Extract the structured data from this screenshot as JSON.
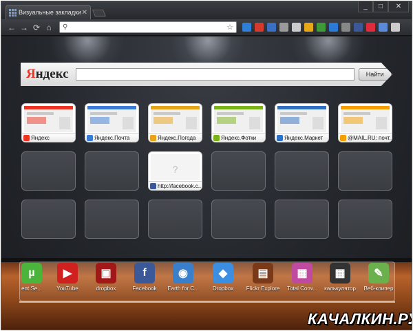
{
  "tab": {
    "title": "Визуальные закладки",
    "close": "✕"
  },
  "window_buttons": {
    "minimize": "_",
    "maximize": "□",
    "close": "✕"
  },
  "nav": {
    "back": "←",
    "forward": "→",
    "reload": "⟳",
    "home": "⌂"
  },
  "omnibox": {
    "value": "",
    "search_icon": "search-icon",
    "star": "☆"
  },
  "extensions": [
    {
      "name": "extension-1-icon",
      "color": "#2f7fd6"
    },
    {
      "name": "extension-2-icon",
      "color": "#d63a2f"
    },
    {
      "name": "extension-3-icon",
      "color": "#3a6fc4"
    },
    {
      "name": "extension-4-icon",
      "color": "#9a9a9a"
    },
    {
      "name": "extension-5-icon",
      "color": "#cccccc"
    },
    {
      "name": "extension-6-icon",
      "color": "#e6a817"
    },
    {
      "name": "extension-7-icon",
      "color": "#3d9a37"
    },
    {
      "name": "extension-8-icon",
      "color": "#2a7ad6"
    },
    {
      "name": "extension-9-icon",
      "color": "#888888"
    },
    {
      "name": "extension-10-icon",
      "color": "#3b5998"
    },
    {
      "name": "extension-11-icon",
      "color": "#e02b3c"
    },
    {
      "name": "extension-12-icon",
      "color": "#5a8ad8"
    },
    {
      "name": "wrench-icon",
      "color": "#cccccc"
    }
  ],
  "yandex": {
    "logo_first": "Я",
    "logo_rest": "ндекс",
    "search_value": "",
    "button": "Найти"
  },
  "bookmarks": [
    {
      "label": "Яндекс",
      "color": "#e32"
    },
    {
      "label": "Яндекс.Почта",
      "color": "#3a7bd5"
    },
    {
      "label": "Яндекс.Погода",
      "color": "#e8a317"
    },
    {
      "label": "Яндекс.Фотки",
      "color": "#7ab317"
    },
    {
      "label": "Яндекс.Маркет",
      "color": "#2f6fc4"
    },
    {
      "label": "@MAIL.RU: почт...",
      "color": "#f4a000"
    },
    {
      "label": "http://facebook.c...",
      "color": "#3b5998",
      "placeholder": "?"
    }
  ],
  "dock_apps": [
    {
      "label": "ent Se...",
      "icon": "µ",
      "color": "#4bb43a",
      "icon_name": "utorrent-icon"
    },
    {
      "label": "YouTube",
      "icon": "▶",
      "color": "#d02020",
      "icon_name": "youtube-icon"
    },
    {
      "label": "dropbox",
      "icon": "▣",
      "color": "#a01818",
      "icon_name": "dropbox-red-icon"
    },
    {
      "label": "Facebook",
      "icon": "f",
      "color": "#3b5998",
      "icon_name": "facebook-icon"
    },
    {
      "label": "Earth for C...",
      "icon": "◉",
      "color": "#3a7fc9",
      "icon_name": "earth-icon"
    },
    {
      "label": "Dropbox",
      "icon": "◆",
      "color": "#3b8ee0",
      "icon_name": "dropbox-icon"
    },
    {
      "label": "Flickr Explore",
      "icon": "▤",
      "color": "#7a3a1a",
      "icon_name": "flickr-icon"
    },
    {
      "label": "Total Conv...",
      "icon": "▦",
      "color": "#c04aa0",
      "icon_name": "total-converter-icon"
    },
    {
      "label": "калькулятор",
      "icon": "▦",
      "color": "#333333",
      "icon_name": "calculator-icon"
    },
    {
      "label": "Веб-клипер",
      "icon": "✎",
      "color": "#6ab04c",
      "icon_name": "evernote-icon"
    }
  ],
  "watermark": "КАЧАЛКИН.РУ"
}
